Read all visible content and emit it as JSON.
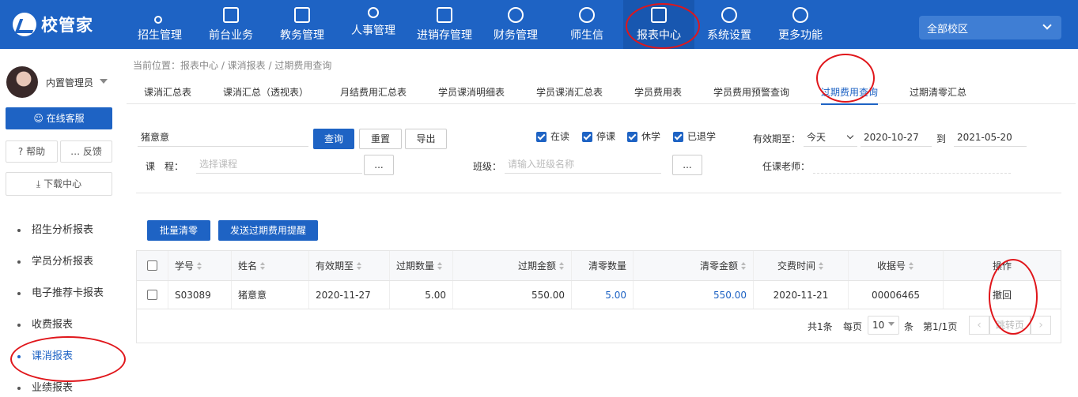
{
  "app": {
    "logo_text": "校管家"
  },
  "nav": [
    {
      "label": "招生管理",
      "icon": "user-plus-icon"
    },
    {
      "label": "前台业务",
      "icon": "monitor-icon"
    },
    {
      "label": "教务管理",
      "icon": "book-icon"
    },
    {
      "label": "人事管理",
      "icon": "person-icon"
    },
    {
      "label": "进销存管理",
      "icon": "inventory-icon"
    },
    {
      "label": "财务管理",
      "icon": "money-icon"
    },
    {
      "label": "师生信",
      "icon": "chat-icon"
    },
    {
      "label": "报表中心",
      "icon": "report-icon"
    },
    {
      "label": "系统设置",
      "icon": "settings-icon"
    },
    {
      "label": "更多功能",
      "icon": "more-icon"
    }
  ],
  "campus": {
    "selected": "全部校区"
  },
  "user": {
    "name": "内置管理员"
  },
  "sidebar": {
    "service_label": "在线客服",
    "help_label": "帮助",
    "feedback_label": "反馈",
    "download_label": "下载中心",
    "menu": [
      {
        "label": "招生分析报表"
      },
      {
        "label": "学员分析报表"
      },
      {
        "label": "电子推荐卡报表"
      },
      {
        "label": "收费报表"
      },
      {
        "label": "课消报表",
        "active": true
      },
      {
        "label": "业绩报表"
      }
    ]
  },
  "breadcrumb": "当前位置：报表中心 / 课消报表 / 过期费用查询",
  "tabs": [
    {
      "label": "课消汇总表"
    },
    {
      "label": "课消汇总（透视表）"
    },
    {
      "label": "月结费用汇总表"
    },
    {
      "label": "学员课消明细表"
    },
    {
      "label": "学员课消汇总表"
    },
    {
      "label": "学员费用表"
    },
    {
      "label": "学员费用预警查询"
    },
    {
      "label": "过期费用查询",
      "active": true
    },
    {
      "label": "过期清零汇总"
    }
  ],
  "filters": {
    "name_value": "猪意意",
    "query_label": "查询",
    "reset_label": "重置",
    "export_label": "导出",
    "status": [
      {
        "label": "在读",
        "checked": true
      },
      {
        "label": "停课",
        "checked": true
      },
      {
        "label": "休学",
        "checked": true
      },
      {
        "label": "已退学",
        "checked": true
      }
    ],
    "valid_until_label": "有效期至：",
    "valid_until_option": "今天",
    "date_from": "2020-10-27",
    "to_label": "到",
    "date_to": "2021-05-20",
    "course_label": "课　程：",
    "course_placeholder": "选择课程",
    "ellipsis": "...",
    "class_label": "班级：",
    "class_placeholder": "请输入班级名称",
    "teacher_label": "任课老师："
  },
  "actions": {
    "batch_clear_label": "批量清零",
    "send_reminder_label": "发送过期费用提醒"
  },
  "table": {
    "columns": [
      "学号",
      "姓名",
      "有效期至",
      "过期数量",
      "过期金额",
      "清零数量",
      "清零金额",
      "交费时间",
      "收据号",
      "操作"
    ],
    "rows": [
      {
        "student_id": "S03089",
        "name": "猪意意",
        "valid_until": "2020-11-27",
        "expired_qty": "5.00",
        "expired_amount": "550.00",
        "cleared_qty": "5.00",
        "cleared_amount": "550.00",
        "pay_time": "2020-11-21",
        "receipt_no": "00006465",
        "action": "撤回"
      }
    ]
  },
  "pagination": {
    "total": "共1条",
    "per_page_label": "每页",
    "per_page_value": "10",
    "unit": "条",
    "page_info": "第1/1页",
    "jump_label": "跳转页",
    "prev": "‹",
    "next": "›"
  },
  "colors": {
    "primary": "#1e63c4",
    "annotation": "#e0161b"
  }
}
